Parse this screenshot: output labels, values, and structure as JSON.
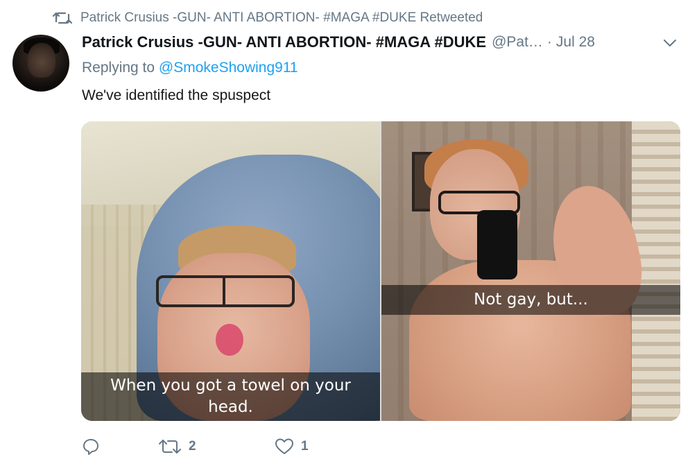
{
  "retweet_banner": {
    "text": "Patrick Crusius -GUN- ANTI ABORTION- #MAGA #DUKE Retweeted",
    "icon": "retweet-icon"
  },
  "tweet": {
    "author_name": "Patrick Crusius -GUN- ANTI ABORTION- #MAGA #DUKE",
    "handle": "@Pat…",
    "separator": "·",
    "date": "Jul 28",
    "reply_prefix": "Replying to",
    "reply_mention": "@SmokeShowing911",
    "text": "We've identified the spuspect",
    "media": [
      {
        "caption_line1": "When you got a towel on your",
        "caption_line2": "head."
      },
      {
        "caption": "Not gay, but..."
      }
    ],
    "actions": {
      "reply_count": "",
      "retweet_count": "2",
      "like_count": "1"
    }
  },
  "colors": {
    "text_primary": "#14171a",
    "text_secondary": "#657786",
    "link": "#1da1f2"
  }
}
